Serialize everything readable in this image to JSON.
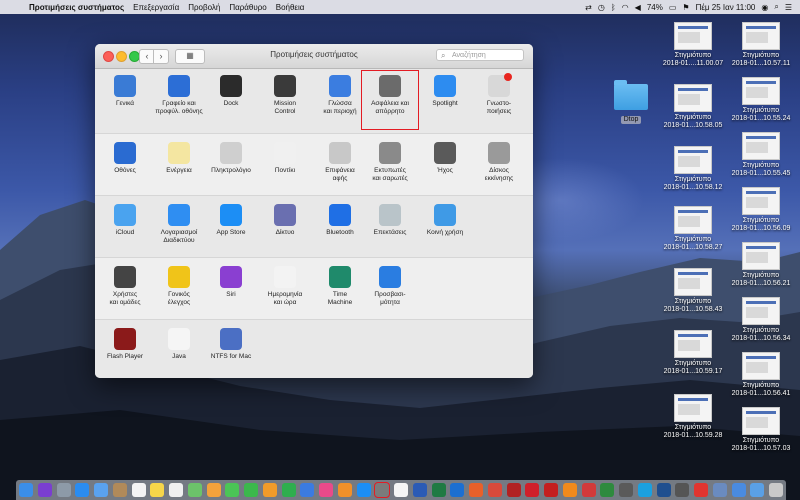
{
  "menubar": {
    "app_name": "Προτιμήσεις συστήματος",
    "menus": [
      "Επεξεργασία",
      "Προβολή",
      "Παράθυρο",
      "Βοήθεια"
    ],
    "battery": "74%",
    "clock": "Πέμ 25 Ιαν 11:00"
  },
  "window": {
    "title": "Προτιμήσεις συστήματος",
    "search_placeholder": "Αναζήτηση",
    "back_glyph": "‹",
    "forward_glyph": "›",
    "grid_glyph": "▦"
  },
  "sections": [
    {
      "items": [
        {
          "label": "Γενικά",
          "icon": "general-icon",
          "color": "#3a7bd5"
        },
        {
          "label": "Γραφείο και\nπροφύλ. οθόνης",
          "icon": "desktop-screensaver-icon",
          "color": "#2c6ed6"
        },
        {
          "label": "Dock",
          "icon": "dock-icon",
          "color": "#2b2b2b"
        },
        {
          "label": "Mission\nControl",
          "icon": "mission-control-icon",
          "color": "#3a3a3a"
        },
        {
          "label": "Γλώσσα\nκαι περιοχή",
          "icon": "language-region-icon",
          "color": "#3b7de0"
        },
        {
          "label": "Ασφάλεια και\nαπόρρητο",
          "icon": "security-privacy-icon",
          "color": "#6b6b6b"
        },
        {
          "label": "Spotlight",
          "icon": "spotlight-icon",
          "color": "#2d8cf0"
        },
        {
          "label": "Γνωστο-\nποιήσεις",
          "icon": "notifications-icon",
          "color": "#d8d8d8"
        }
      ]
    },
    {
      "items": [
        {
          "label": "Οθόνες",
          "icon": "displays-icon",
          "color": "#2a6bd1"
        },
        {
          "label": "Ενέργεια",
          "icon": "energy-icon",
          "color": "#f4e6a1"
        },
        {
          "label": "Πληκτρολόγιο",
          "icon": "keyboard-icon",
          "color": "#cfcfcf"
        },
        {
          "label": "Ποντίκι",
          "icon": "mouse-icon",
          "color": "#f0f0f0"
        },
        {
          "label": "Επιφάνεια\nαφής",
          "icon": "trackpad-icon",
          "color": "#c8c8c8"
        },
        {
          "label": "Εκτυπωτές\nκαι σαρωτές",
          "icon": "printers-icon",
          "color": "#8a8a8a"
        },
        {
          "label": "Ήχος",
          "icon": "sound-icon",
          "color": "#5a5a5a"
        },
        {
          "label": "Δίσκος\nεκκίνησης",
          "icon": "startup-disk-icon",
          "color": "#9a9a9a"
        }
      ]
    },
    {
      "items": [
        {
          "label": "iCloud",
          "icon": "icloud-icon",
          "color": "#4aa3ef"
        },
        {
          "label": "Λογαριασμοί\nΔιαδικτύου",
          "icon": "internet-accounts-icon",
          "color": "#2f8ef2"
        },
        {
          "label": "App Store",
          "icon": "app-store-icon",
          "color": "#1c8ef5"
        },
        {
          "label": "Δίκτυο",
          "icon": "network-icon",
          "color": "#6a6fb0"
        },
        {
          "label": "Bluetooth",
          "icon": "bluetooth-icon",
          "color": "#1f6fe5"
        },
        {
          "label": "Επεκτάσεις",
          "icon": "extensions-icon",
          "color": "#b9c4c9"
        },
        {
          "label": "Κοινή χρήση",
          "icon": "sharing-icon",
          "color": "#3f9ae6"
        }
      ]
    },
    {
      "items": [
        {
          "label": "Χρήστες\nκαι ομάδες",
          "icon": "users-groups-icon",
          "color": "#444444"
        },
        {
          "label": "Γονικός\nέλεγχος",
          "icon": "parental-controls-icon",
          "color": "#f0c419"
        },
        {
          "label": "Siri",
          "icon": "siri-icon",
          "color": "#8a3fd1"
        },
        {
          "label": "Ημερομηνία\nκαι ώρα",
          "icon": "date-time-icon",
          "color": "#f3f3f3"
        },
        {
          "label": "Time\nMachine",
          "icon": "time-machine-icon",
          "color": "#1f8a6b"
        },
        {
          "label": "Προσβασι-\nμότητα",
          "icon": "accessibility-icon",
          "color": "#2a7de1"
        }
      ]
    },
    {
      "items": [
        {
          "label": "Flash Player",
          "icon": "flash-player-icon",
          "color": "#8b1a1a"
        },
        {
          "label": "Java",
          "icon": "java-icon",
          "color": "#f5f5f5"
        },
        {
          "label": "NTFS for Mac",
          "icon": "ntfs-icon",
          "color": "#4b6fc4"
        }
      ]
    }
  ],
  "desktop": {
    "folder": "Dtop",
    "col1": [
      "Στιγμιότυπο\n2018-01....11.00.07",
      "Στιγμιότυπο\n2018-01...10.58.05",
      "Στιγμιότυπο\n2018-01...10.58.12",
      "Στιγμιότυπο\n2018-01...10.58.27",
      "Στιγμιότυπο\n2018-01...10.58.43",
      "Στιγμιότυπο\n2018-01...10.59.17",
      "Στιγμιότυπο\n2018-01...10.59.28"
    ],
    "col2": [
      "Στιγμιότυπο\n2018-01...10.57.11",
      "Στιγμιότυπο\n2018-01...10.55.24",
      "Στιγμιότυπο\n2018-01...10.55.45",
      "Στιγμιότυπο\n2018-01...10.56.09",
      "Στιγμιότυπο\n2018-01...10.56.21",
      "Στιγμιότυπο\n2018-01...10.56.34",
      "Στιγμιότυπο\n2018-01...10.56.41",
      "Στιγμιότυπο\n2018-01...10.57.03"
    ]
  },
  "dock": [
    {
      "icon": "finder-icon",
      "color": "#3b8ee8"
    },
    {
      "icon": "siri-icon",
      "color": "#7a3ed0"
    },
    {
      "icon": "launchpad-icon",
      "color": "#8d9aa8"
    },
    {
      "icon": "safari-icon",
      "color": "#2a8cf0"
    },
    {
      "icon": "mail-icon",
      "color": "#5aa2ee"
    },
    {
      "icon": "contacts-icon",
      "color": "#b08a5a"
    },
    {
      "icon": "calendar-icon",
      "color": "#f4f4f4"
    },
    {
      "icon": "notes-icon",
      "color": "#f6d64a"
    },
    {
      "icon": "reminders-icon",
      "color": "#f0f0f0"
    },
    {
      "icon": "maps-icon",
      "color": "#6cc36a"
    },
    {
      "icon": "photos-icon",
      "color": "#f3a23b"
    },
    {
      "icon": "messages-icon",
      "color": "#4bc556"
    },
    {
      "icon": "facetime-icon",
      "color": "#3bb84c"
    },
    {
      "icon": "pages-icon",
      "color": "#f09b2a"
    },
    {
      "icon": "numbers-icon",
      "color": "#2fae4e"
    },
    {
      "icon": "keynote-icon",
      "color": "#3b7be0"
    },
    {
      "icon": "itunes-icon",
      "color": "#e94a8a"
    },
    {
      "icon": "ibooks-icon",
      "color": "#f0902a"
    },
    {
      "icon": "app-store-icon",
      "color": "#1c8ef5"
    },
    {
      "icon": "system-preferences-icon",
      "color": "#7b7b7b",
      "selected": true
    },
    {
      "icon": "textedit-icon",
      "color": "#f5f5f5"
    },
    {
      "icon": "word-icon",
      "color": "#2b5bb5"
    },
    {
      "icon": "excel-icon",
      "color": "#1f7a43"
    },
    {
      "icon": "teamviewer-icon",
      "color": "#1c6fd1"
    },
    {
      "icon": "firefox-icon",
      "color": "#e8602a"
    },
    {
      "icon": "chrome-icon",
      "color": "#d94a3b"
    },
    {
      "icon": "photo-booth-icon",
      "color": "#b22222"
    },
    {
      "icon": "opera-icon",
      "color": "#d0202a"
    },
    {
      "icon": "acrobat-icon",
      "color": "#c41f1f"
    },
    {
      "icon": "vlc-icon",
      "color": "#f08a1c"
    },
    {
      "icon": "ninja-icon",
      "color": "#d23a3a"
    },
    {
      "icon": "antivirus-icon",
      "color": "#2e8a3e"
    },
    {
      "icon": "utility-icon",
      "color": "#5a5a5a"
    },
    {
      "icon": "skype-icon",
      "color": "#1aa0e0"
    },
    {
      "icon": "vpn-icon",
      "color": "#1f4f8f"
    },
    {
      "icon": "calculator-icon",
      "color": "#555555"
    },
    {
      "icon": "anydesk-icon",
      "color": "#e1352f"
    },
    {
      "icon": "preview-icon",
      "color": "#6a8bc0"
    },
    {
      "icon": "downloads-icon",
      "color": "#4a8be0"
    },
    {
      "icon": "folder-icon",
      "color": "#5aa0e6"
    },
    {
      "icon": "trash-icon",
      "color": "#c9c9c9"
    }
  ]
}
